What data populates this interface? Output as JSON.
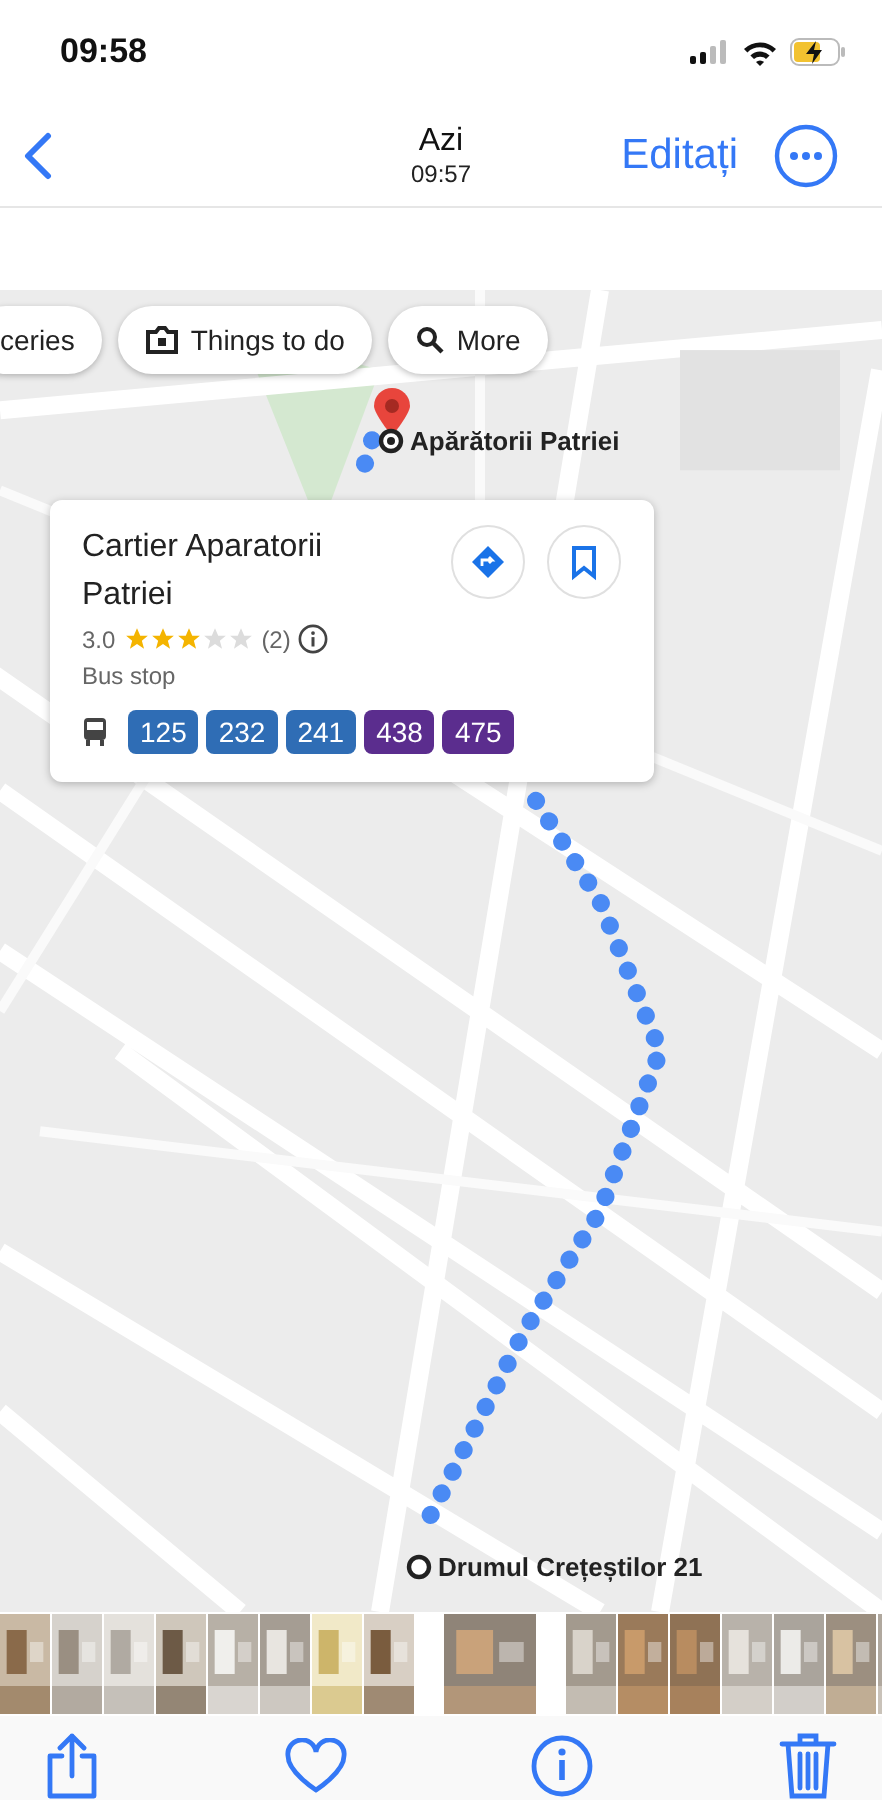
{
  "status_bar": {
    "time": "09:58"
  },
  "nav": {
    "title": "Azi",
    "subtitle": "09:57",
    "edit": "Editați"
  },
  "map": {
    "chips": [
      {
        "label": "ceries",
        "kind": "plain"
      },
      {
        "label": "Things to do",
        "kind": "camera"
      },
      {
        "label": "More",
        "kind": "search"
      }
    ],
    "places": [
      {
        "label": "Apărătorii Patriei",
        "kind": "start"
      },
      {
        "label": "Drumul Crețeștilor 21",
        "kind": "end"
      }
    ],
    "card": {
      "title": "Cartier Aparatorii Patriei",
      "rating": "3.0",
      "stars": 3,
      "reviews": "(2)",
      "type": "Bus stop",
      "routes": [
        {
          "label": "125",
          "color": "#2f6db5"
        },
        {
          "label": "232",
          "color": "#2f6db5"
        },
        {
          "label": "241",
          "color": "#2f6db5"
        },
        {
          "label": "438",
          "color": "#5b2d8e"
        },
        {
          "label": "475",
          "color": "#5b2d8e"
        }
      ]
    }
  }
}
